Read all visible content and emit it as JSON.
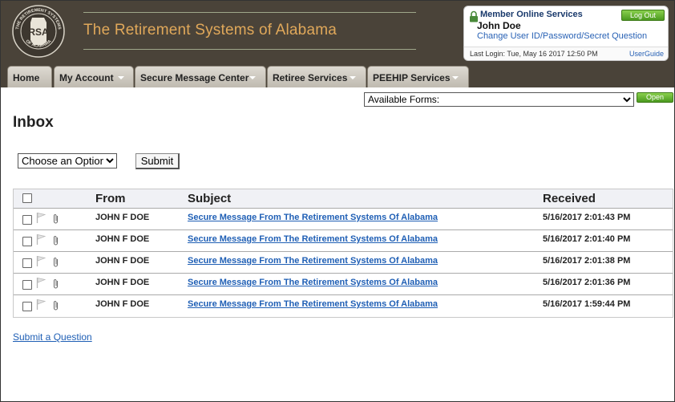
{
  "header": {
    "logo_text": "RSA",
    "logo_ring_top": "THE RETIREMENT SYSTEMS",
    "logo_ring_bottom": "OF ALABAMA",
    "site_title": "The Retirement Systems of Alabama"
  },
  "member": {
    "heading": "Member Online Services",
    "name": "John Doe",
    "change_link": "Change User ID/Password/Secret Question",
    "logout_label": "Log Out",
    "last_login": "Last Login: Tue, May 16 2017 12:50 PM",
    "user_guide": "UserGuide"
  },
  "nav": {
    "tabs": [
      {
        "label": "Home",
        "has_arrow": false
      },
      {
        "label": "My Account",
        "has_arrow": true
      },
      {
        "label": "Secure Message Center",
        "has_arrow": true
      },
      {
        "label": "Retiree Services",
        "has_arrow": true
      },
      {
        "label": "PEEHIP Services",
        "has_arrow": true
      }
    ]
  },
  "forms": {
    "selected": "Available Forms:",
    "open_label": "Open"
  },
  "inbox": {
    "title": "Inbox",
    "action_selected": "Choose an Option",
    "submit_label": "Submit",
    "columns": {
      "from": "From",
      "subject": "Subject",
      "received": "Received"
    },
    "messages": [
      {
        "from": "JOHN F DOE",
        "subject": "Secure Message From The Retirement Systems Of Alabama",
        "received": "5/16/2017 2:01:43 PM"
      },
      {
        "from": "JOHN F DOE",
        "subject": "Secure Message From The Retirement Systems Of Alabama",
        "received": "5/16/2017 2:01:40 PM"
      },
      {
        "from": "JOHN F DOE",
        "subject": "Secure Message From The Retirement Systems Of Alabama",
        "received": "5/16/2017 2:01:38 PM"
      },
      {
        "from": "JOHN F DOE",
        "subject": "Secure Message From The Retirement Systems Of Alabama",
        "received": "5/16/2017 2:01:36 PM"
      },
      {
        "from": "JOHN F DOE",
        "subject": "Secure Message From The Retirement Systems Of Alabama",
        "received": "5/16/2017 1:59:44 PM"
      }
    ]
  },
  "footer": {
    "submit_question": "Submit a Question"
  },
  "colors": {
    "header_bg": "#4a4339",
    "title_orange": "#e0a85a",
    "link_blue": "#1f5fb5",
    "green_button": "#4b9a1f"
  }
}
